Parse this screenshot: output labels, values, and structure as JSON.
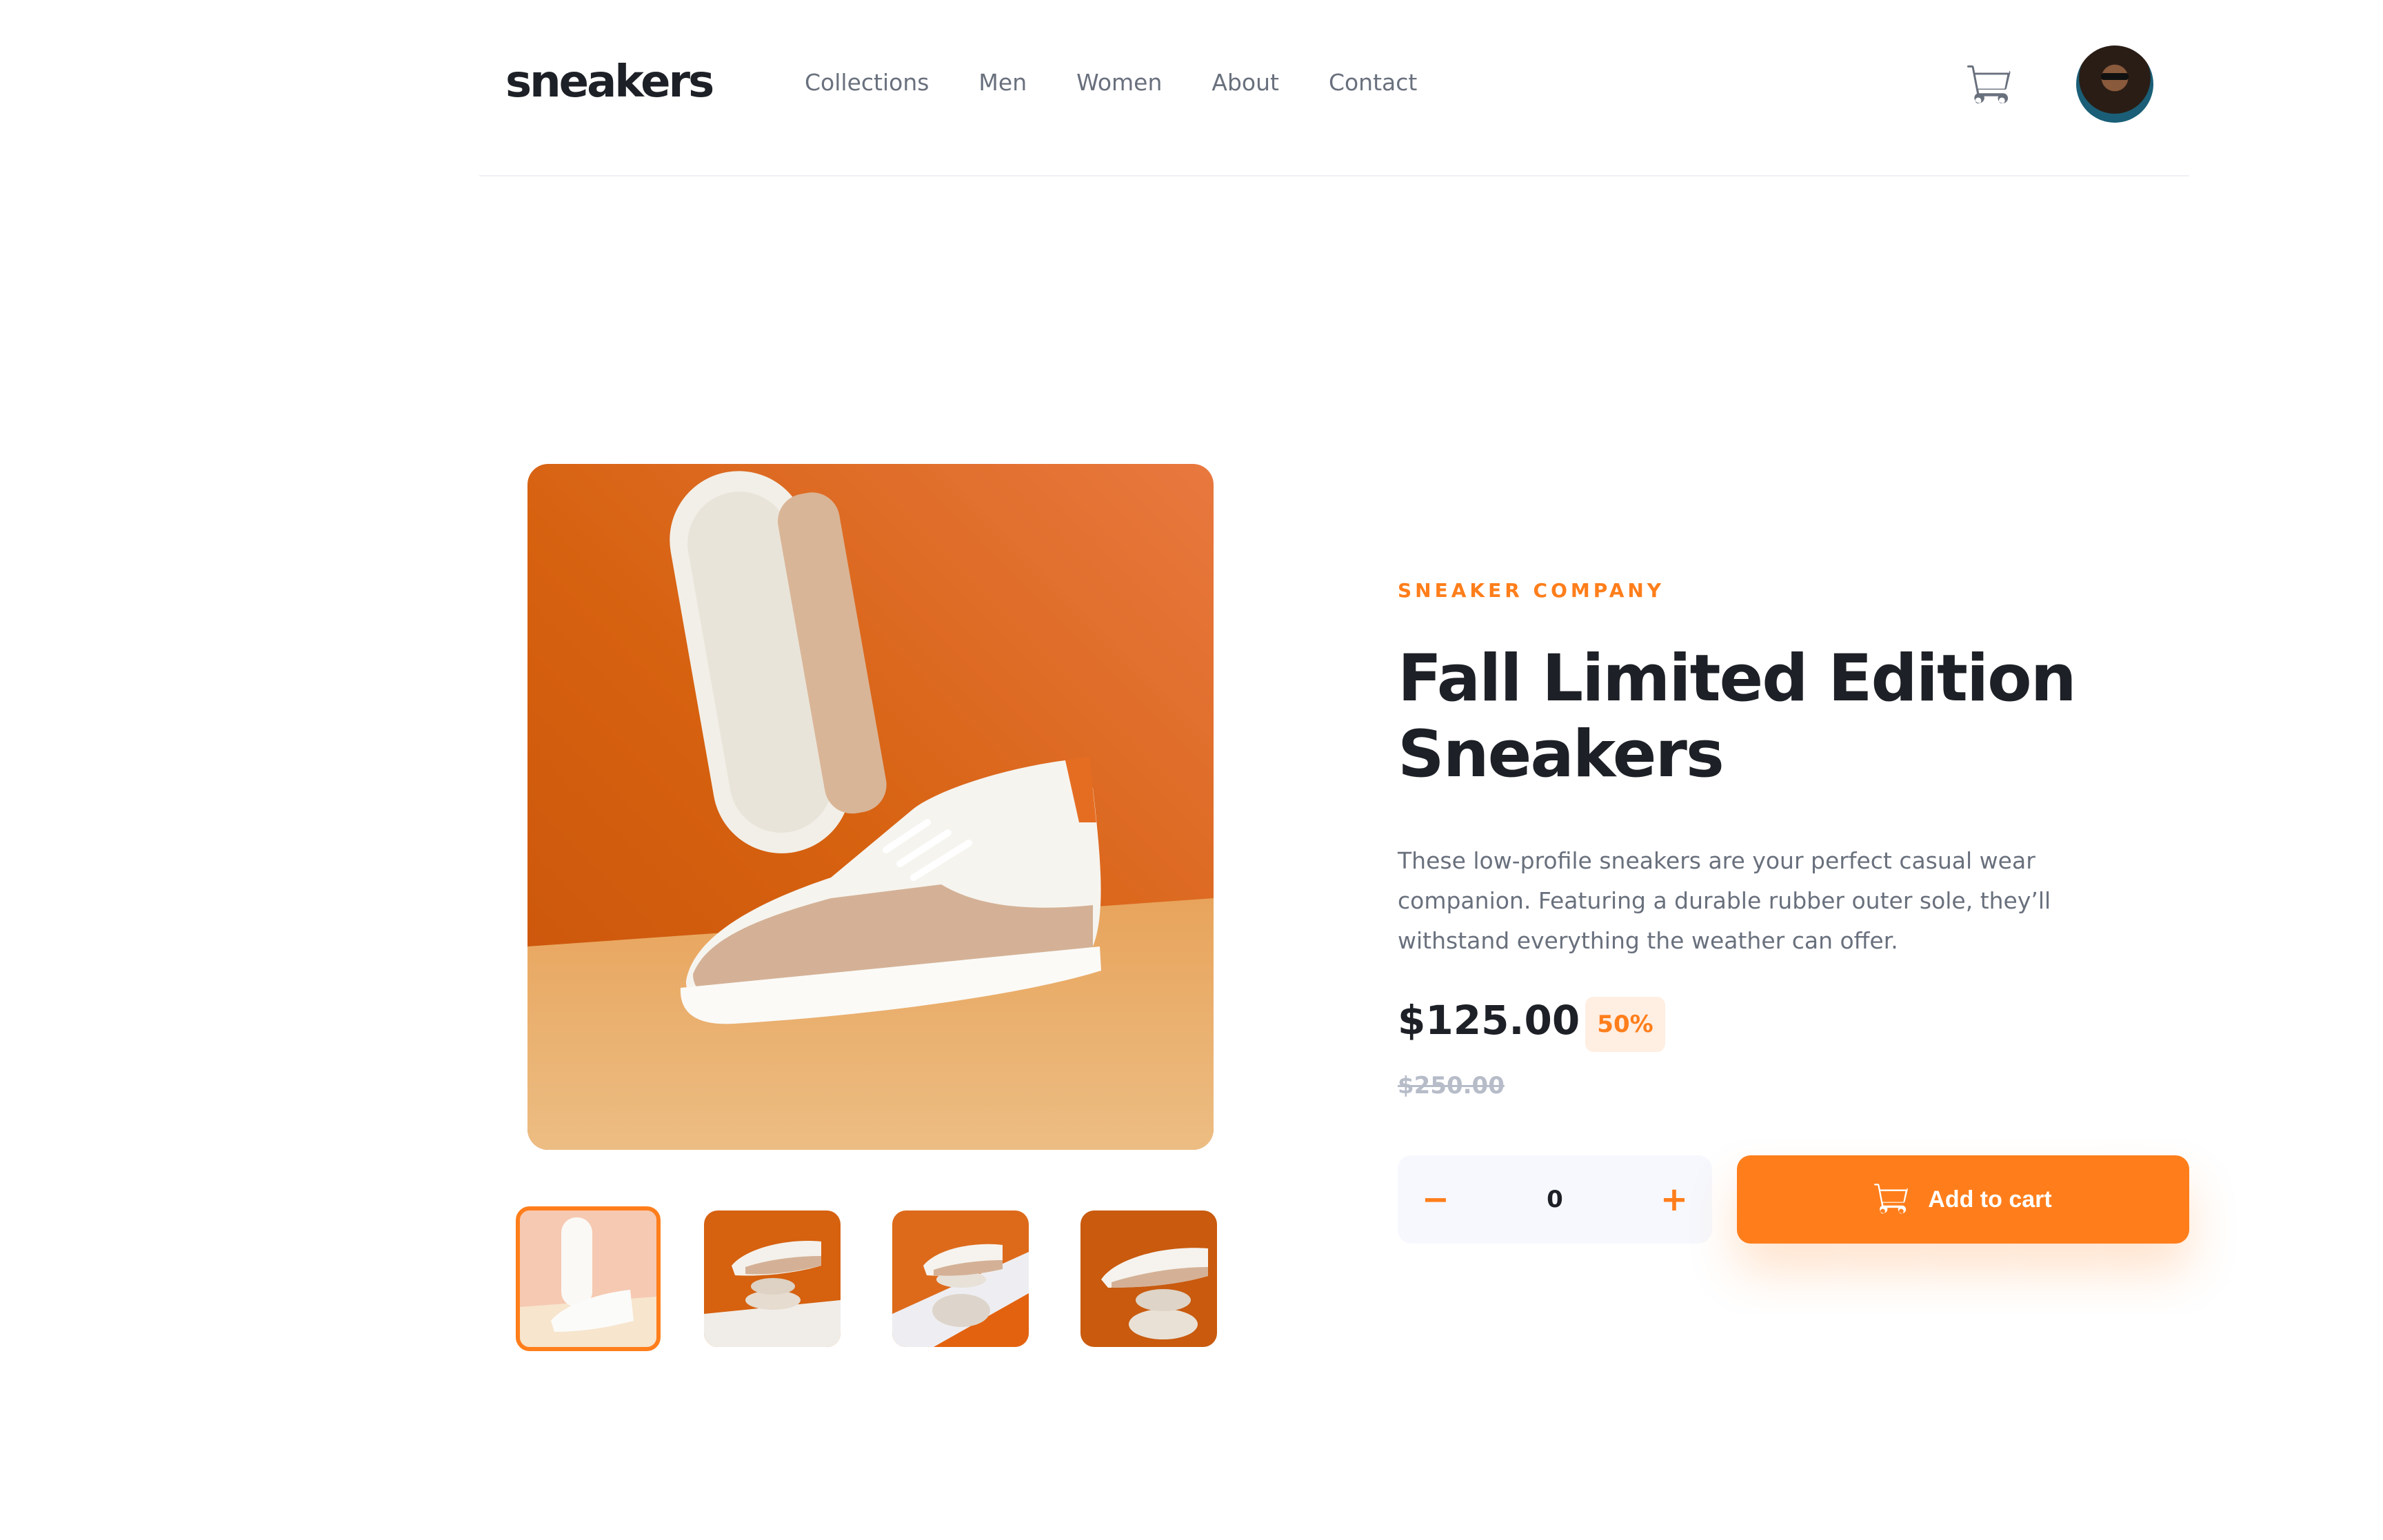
{
  "brand": {
    "logo_text": "sneakers",
    "accent_color": "#ff7e1b",
    "accent_pale": "#ffeee2",
    "text_dark": "#1d2026",
    "text_gray": "#69707d"
  },
  "nav": {
    "items": [
      {
        "label": "Collections"
      },
      {
        "label": "Men"
      },
      {
        "label": "Women"
      },
      {
        "label": "About"
      },
      {
        "label": "Contact"
      }
    ]
  },
  "header": {
    "cart_icon": "cart-icon",
    "avatar_icon": "user-avatar"
  },
  "gallery": {
    "main_image": "product-photo-1",
    "thumbnails": [
      {
        "name": "thumbnail-1",
        "active": true
      },
      {
        "name": "thumbnail-2",
        "active": false
      },
      {
        "name": "thumbnail-3",
        "active": false
      },
      {
        "name": "thumbnail-4",
        "active": false
      }
    ]
  },
  "product": {
    "company": "SNEAKER COMPANY",
    "title": "Fall Limited Edition Sneakers",
    "description": "These low-profile sneakers are your perfect casual wear companion. Featuring a durable rubber outer sole, they’ll withstand everything the weather can offer.",
    "price": "$125.00",
    "discount": "50%",
    "original_price": "$250.00"
  },
  "cart_controls": {
    "minus_symbol": "−",
    "plus_symbol": "+",
    "quantity": "0",
    "add_to_cart_label": "Add to cart"
  }
}
